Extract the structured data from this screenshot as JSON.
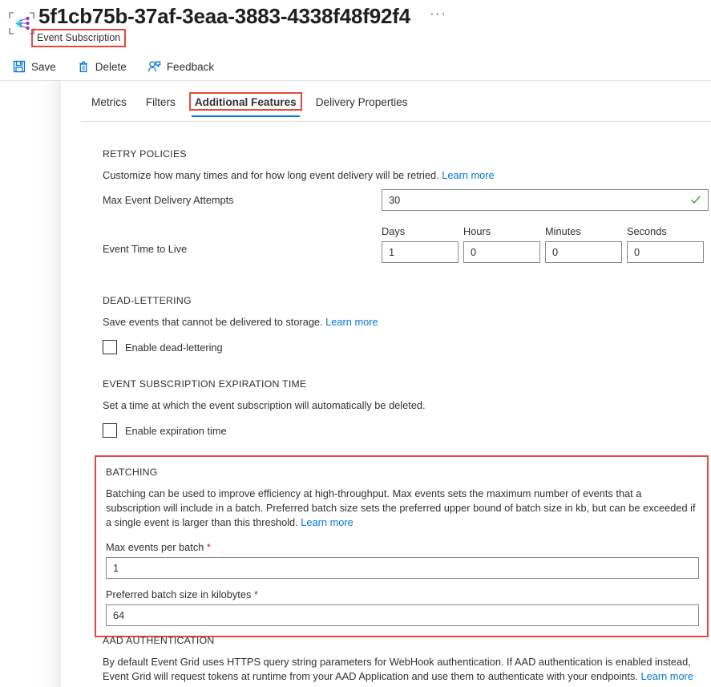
{
  "header": {
    "title": "5f1cb75b-37af-3eaa-3883-4338f48f92f4",
    "subtitle": "Event Subscription",
    "more_label": "···",
    "resource_icon": "event-grid-subscription-icon",
    "highlight_color": "#e8483c"
  },
  "commandbar": {
    "items": [
      {
        "label": "Save",
        "icon": "save-icon"
      },
      {
        "label": "Delete",
        "icon": "trash-icon"
      },
      {
        "label": "Feedback",
        "icon": "feedback-person-icon"
      }
    ]
  },
  "tabs": [
    {
      "label": "Metrics",
      "active": false
    },
    {
      "label": "Filters",
      "active": false
    },
    {
      "label": "Additional Features",
      "active": true
    },
    {
      "label": "Delivery Properties",
      "active": false
    }
  ],
  "retry": {
    "section_title": "RETRY POLICIES",
    "description": "Customize how many times and for how long event delivery will be retried.",
    "learn_more": "Learn more",
    "max_attempts_label": "Max Event Delivery Attempts",
    "max_attempts_value": "30",
    "validation_icon": "checkmark-icon",
    "ttl_label": "Event Time to Live",
    "ttl_fields": [
      {
        "caption": "Days",
        "value": "1"
      },
      {
        "caption": "Hours",
        "value": "0"
      },
      {
        "caption": "Minutes",
        "value": "0"
      },
      {
        "caption": "Seconds",
        "value": "0"
      }
    ]
  },
  "dead_lettering": {
    "section_title": "DEAD-LETTERING",
    "description": "Save events that cannot be delivered to storage.",
    "learn_more": "Learn more",
    "checkbox_label": "Enable dead-lettering",
    "checked": false
  },
  "expiration": {
    "section_title": "EVENT SUBSCRIPTION EXPIRATION TIME",
    "description": "Set a time at which the event subscription will automatically be deleted.",
    "checkbox_label": "Enable expiration time",
    "checked": false
  },
  "batching": {
    "section_title": "BATCHING",
    "description": "Batching can be used to improve efficiency at high-throughput. Max events sets the maximum number of events that a subscription will include in a batch. Preferred batch size sets the preferred upper bound of batch size in kb, but can be exceeded if a single event is larger than this threshold.",
    "learn_more": "Learn more",
    "max_events_label": "Max events per batch",
    "max_events_value": "1",
    "batch_size_label": "Preferred batch size in kilobytes",
    "batch_size_value": "64",
    "required_marker": "*"
  },
  "aad": {
    "section_title": "AAD AUTHENTICATION",
    "description": "By default Event Grid uses HTTPS query string parameters for WebHook authentication. If AAD authentication is enabled instead, Event Grid will request tokens at runtime from your AAD Application and use them to authenticate with your endpoints.",
    "learn_more": "Learn more"
  }
}
